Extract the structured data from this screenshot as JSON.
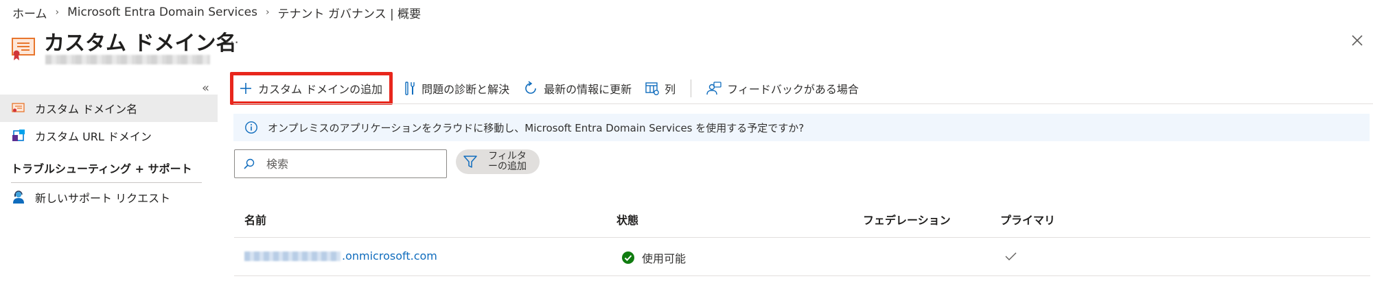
{
  "breadcrumb": [
    "ホーム",
    "Microsoft Entra Domain Services",
    "テナント ガバナンス | 概要"
  ],
  "header": {
    "title": "カスタム ドメイン名",
    "more": "…"
  },
  "sidebar": {
    "items": [
      {
        "label": "カスタム ドメイン名",
        "icon": "domain-certificate-icon",
        "active": true
      },
      {
        "label": "カスタム URL ドメイン",
        "icon": "url-domain-icon",
        "active": false
      }
    ],
    "section_title": "トラブルシューティング + サポート",
    "support_items": [
      {
        "label": "新しいサポート リクエスト",
        "icon": "support-person-icon"
      }
    ]
  },
  "toolbar": {
    "add_domain": "カスタム ドメインの追加",
    "diagnose": "問題の診断と解決",
    "refresh": "最新の情報に更新",
    "columns": "列",
    "feedback": "フィードバックがある場合"
  },
  "banner": {
    "text": "オンプレミスのアプリケーションをクラウドに移動し、Microsoft Entra Domain Services を使用する予定ですか?"
  },
  "search": {
    "placeholder": "検索"
  },
  "filter": {
    "label": "フィルターの追加",
    "line1": "フィルタ",
    "line2": "ーの追加"
  },
  "table": {
    "columns": [
      "名前",
      "状態",
      "フェデレーション",
      "プライマリ"
    ],
    "rows": [
      {
        "name_suffix": ".onmicrosoft.com",
        "status": "使用可能",
        "federation": "",
        "primary": true
      }
    ]
  },
  "colors": {
    "accent": "#0f6cbd",
    "highlight_border": "#e8261c",
    "status_ok": "#107c10",
    "banner_bg": "#f0f6fd"
  }
}
